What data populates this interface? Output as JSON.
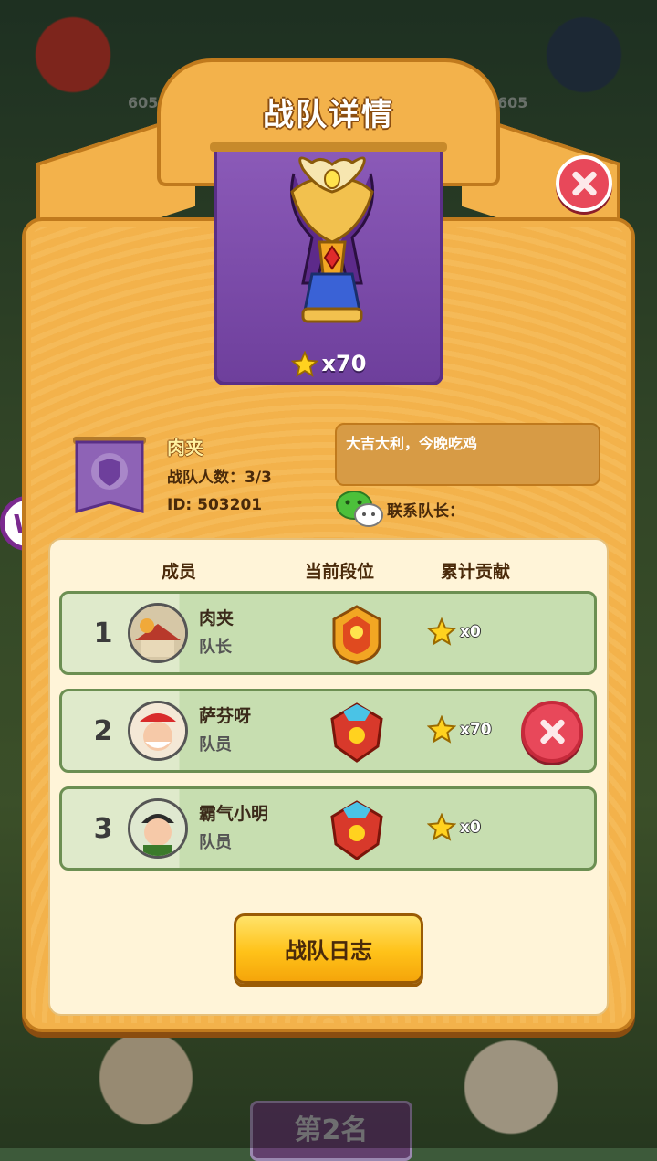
{
  "window": {
    "title": "战队详情"
  },
  "background": {
    "rank_label": "第2名",
    "score_left": "605",
    "score_right": "605"
  },
  "banner": {
    "star_count": "x70"
  },
  "team": {
    "name": "肉夹",
    "members_text": "战队人数：3/3",
    "id_text": "ID: 503201",
    "motto": "大吉大利，今晚吃鸡",
    "contact_label": "联系队长："
  },
  "table": {
    "headers": {
      "member": "成员",
      "rank": "当前段位",
      "contribution": "累计贡献"
    },
    "rows": [
      {
        "rank": "1",
        "name": "肉夹",
        "role": "队长",
        "contribution": "x0"
      },
      {
        "rank": "2",
        "name": "萨芬呀",
        "role": "队员",
        "contribution": "x70"
      },
      {
        "rank": "3",
        "name": "霸气小明",
        "role": "队员",
        "contribution": "x0"
      }
    ]
  },
  "buttons": {
    "log_label": "战队日志"
  },
  "colors": {
    "panel": "#f3b24b",
    "banner": "#7b4aa8",
    "close": "#e8485a",
    "button": "#ffc219"
  },
  "icons": [
    "close-icon",
    "trophy-icon",
    "star-icon",
    "shield-icon",
    "wechat-icon",
    "rank-badge-icon"
  ]
}
